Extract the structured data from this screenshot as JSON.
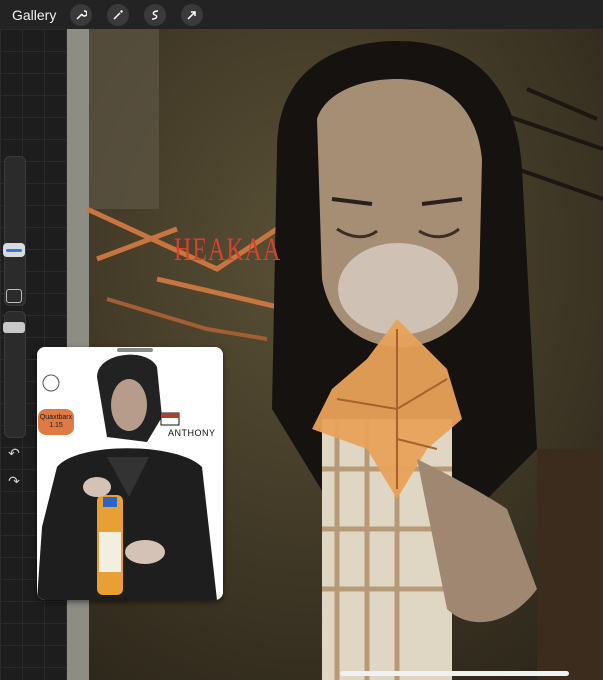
{
  "topbar": {
    "gallery_label": "Gallery",
    "tools": [
      "wrench-icon",
      "magic-wand-icon",
      "selection-icon",
      "transform-arrow-icon"
    ]
  },
  "sidebar": {
    "brush_size_thumb": "brush-size-thumb",
    "modify_button": "square-modify-icon",
    "opacity_thumb": "opacity-thumb",
    "undo_icon": "↶",
    "redo_icon": "↷"
  },
  "artwork": {
    "title_text": "HEAKAA"
  },
  "reference": {
    "sticker_text": "Quaxtbarx 1.15",
    "name_text": "ANTHONY"
  },
  "colors": {
    "topbar": "#232323",
    "sidebar": "#1d1d1d",
    "canvas": "#4a3f2e",
    "accent_blue": "#3a78d8",
    "title_red": "#d9412f",
    "leaf_orange": "#e8a25a"
  }
}
